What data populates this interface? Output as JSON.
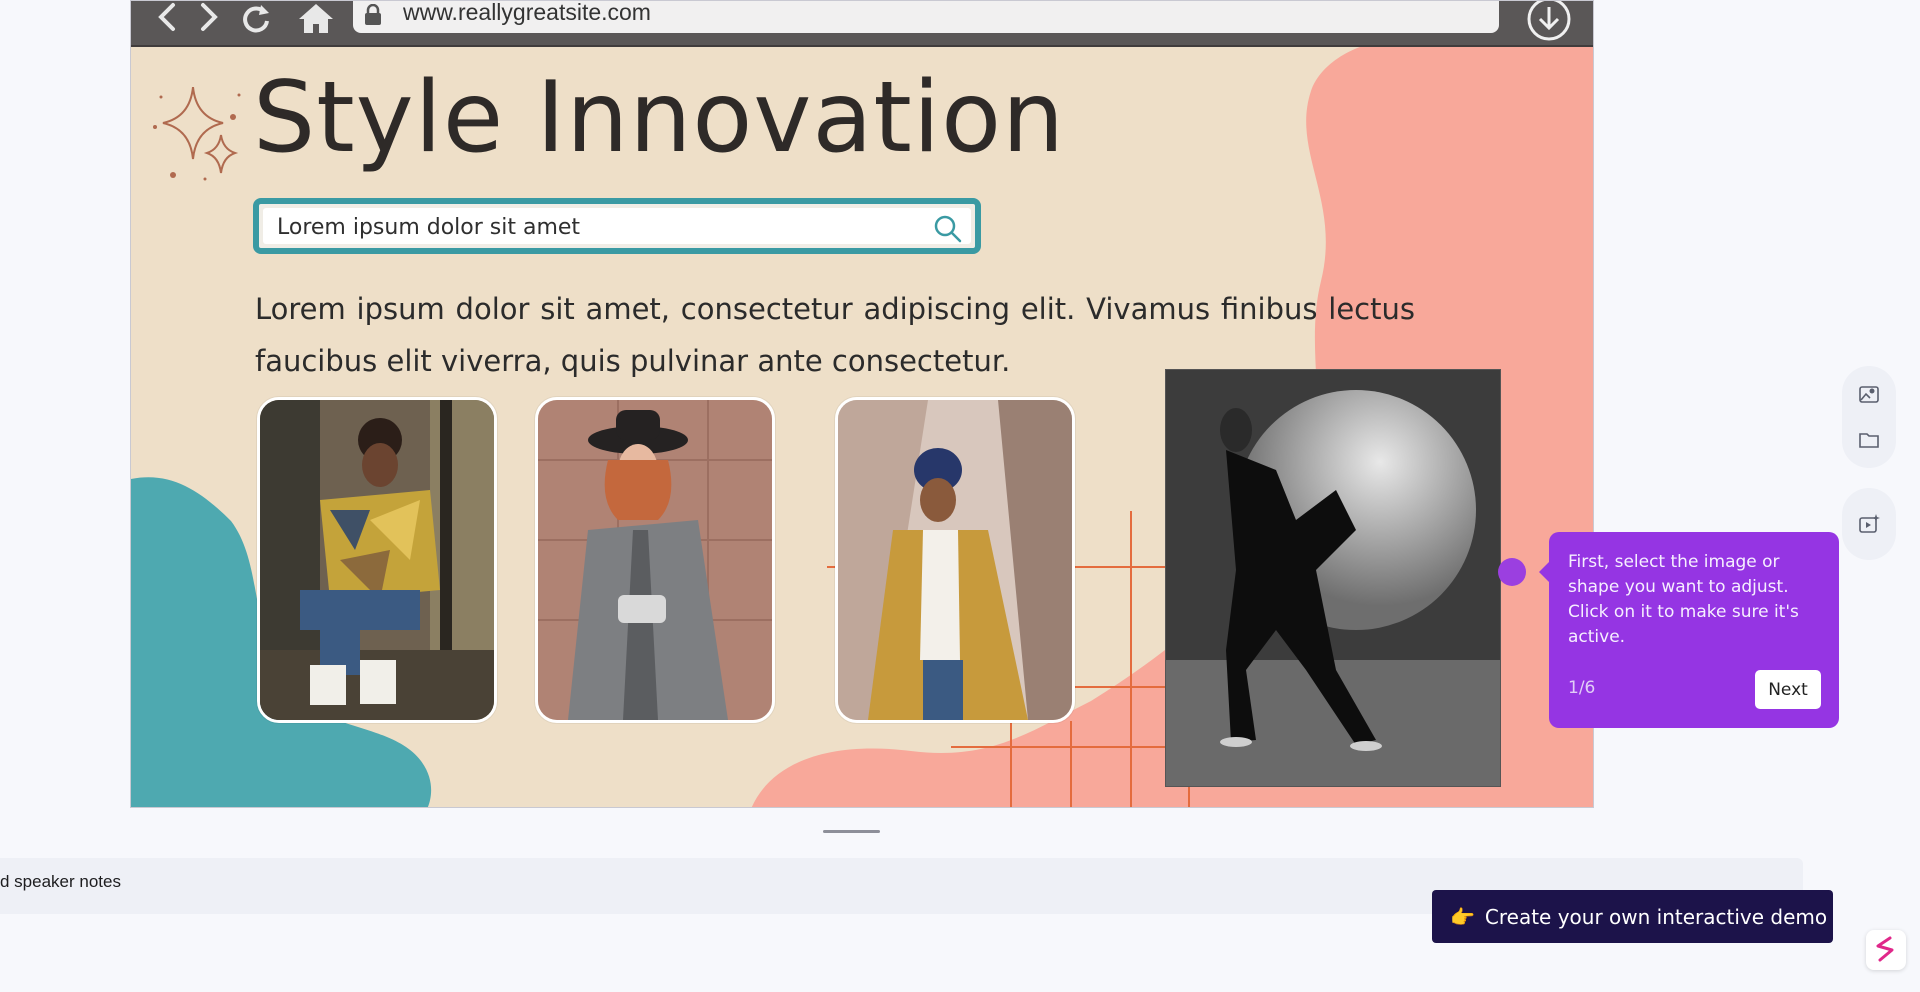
{
  "browser": {
    "url": "www.reallygreatsite.com"
  },
  "slide": {
    "title": "Style Innovation",
    "search_text": "Lorem ipsum dolor sit amet",
    "body_text": "Lorem ipsum dolor sit amet, consectetur adipiscing elit. Vivamus finibus lectus faucibus elit viverra, quis pulvinar ante consectetur."
  },
  "tooltip": {
    "text": "First, select the image or shape you want to adjust. Click on it to make sure it's active.",
    "step": "1/6",
    "next_label": "Next"
  },
  "notes": {
    "label": "d speaker notes"
  },
  "cta": {
    "emoji": "👉",
    "label": "Create your own interactive demo"
  },
  "colors": {
    "slide_bg": "#eedfc8",
    "teal": "#4ea9b0",
    "salmon": "#f8a89a",
    "tooltip": "#9535e3",
    "cta": "#1c134a"
  },
  "icons": {
    "toolbar": [
      "image-person-icon",
      "folder-icon",
      "video-sparkle-icon"
    ],
    "browser": [
      "back-icon",
      "forward-icon",
      "refresh-icon",
      "home-icon",
      "lock-icon",
      "download-icon"
    ]
  }
}
